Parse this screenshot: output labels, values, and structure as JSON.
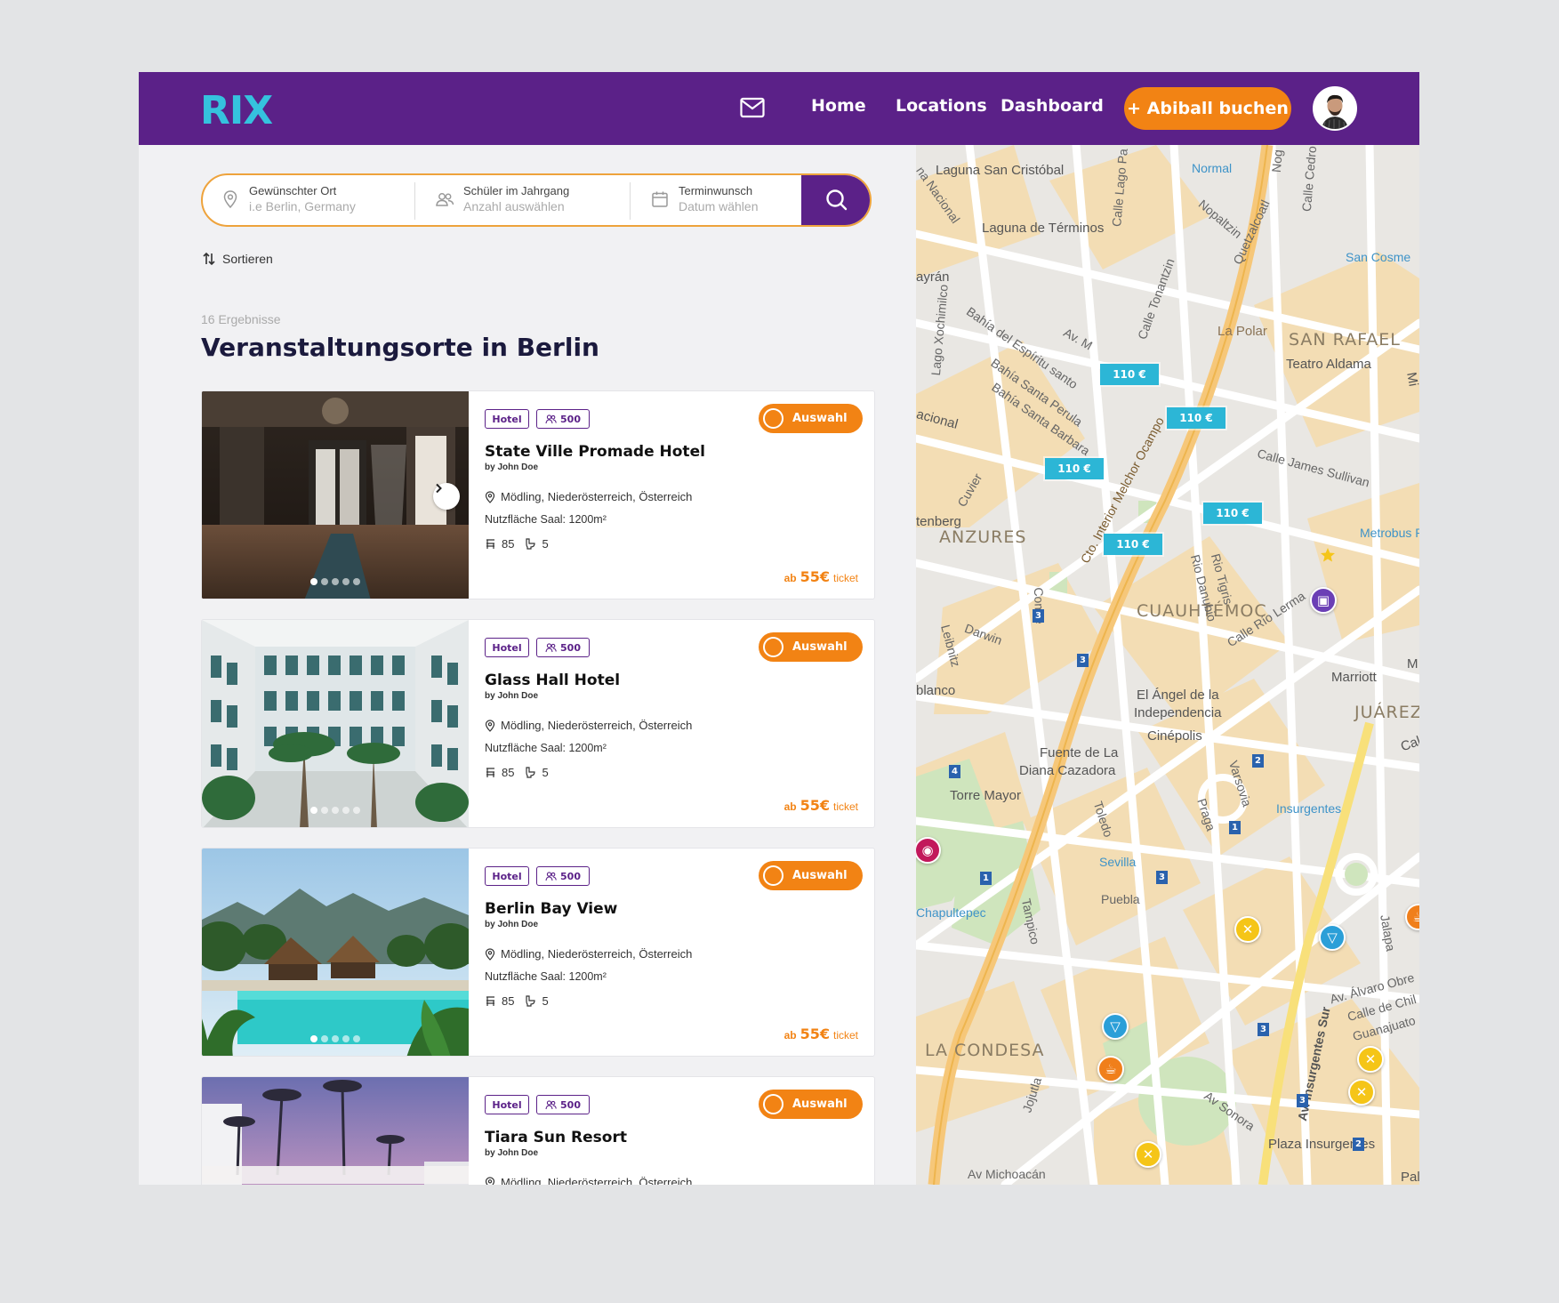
{
  "header": {
    "logo": "RIX",
    "nav": [
      "Home",
      "Locations",
      "Dashboard"
    ],
    "cta": "+ Abiball buchen"
  },
  "search": {
    "location": {
      "label": "Gewünschter Ort",
      "placeholder": "i.e Berlin, Germany"
    },
    "students": {
      "label": "Schüler im Jahrgang",
      "placeholder": "Anzahl auswählen"
    },
    "date": {
      "label": "Terminwunsch",
      "placeholder": "Datum wählen"
    }
  },
  "sort_label": "Sortieren",
  "results_count": "16 Ergebnisse",
  "page_title": "Veranstaltungsorte in Berlin",
  "listings": [
    {
      "tag_type": "Hotel",
      "capacity": "500",
      "select_label": "Auswahl",
      "title": "State Ville Promade Hotel",
      "by": "by John Doe",
      "location": "Mödling, Niederösterreich, Österreich",
      "area": "Nutzfläche Saal: 1200m²",
      "seats": "85",
      "toilets": "5",
      "price_prefix": "ab",
      "price": "55€",
      "price_unit": "ticket"
    },
    {
      "tag_type": "Hotel",
      "capacity": "500",
      "select_label": "Auswahl",
      "title": "Glass Hall Hotel",
      "by": "by John Doe",
      "location": "Mödling, Niederösterreich, Österreich",
      "area": "Nutzfläche Saal: 1200m²",
      "seats": "85",
      "toilets": "5",
      "price_prefix": "ab",
      "price": "55€",
      "price_unit": "ticket"
    },
    {
      "tag_type": "Hotel",
      "capacity": "500",
      "select_label": "Auswahl",
      "title": "Berlin Bay View",
      "by": "by John Doe",
      "location": "Mödling, Niederösterreich, Österreich",
      "area": "Nutzfläche Saal: 1200m²",
      "seats": "85",
      "toilets": "5",
      "price_prefix": "ab",
      "price": "55€",
      "price_unit": "ticket"
    },
    {
      "tag_type": "Hotel",
      "capacity": "500",
      "select_label": "Auswahl",
      "title": "Tiara Sun Resort",
      "by": "by John Doe",
      "location": "Mödling, Niederösterreich, Österreich"
    }
  ],
  "map": {
    "price_pins": [
      "110 €",
      "110 €",
      "110 €",
      "110 €",
      "110 €"
    ],
    "districts": [
      "SAN RAFAEL",
      "ANZURES",
      "CUAUHTÉMOC",
      "JUÁREZ",
      "LA CONDESA"
    ],
    "labels": [
      "Laguna San Cristóbal",
      "Laguna de Términos",
      "Normal",
      "San Cosme",
      "La Polar",
      "Teatro Aldama",
      "Calle James Sullivan",
      "Metrobus R",
      "Marriott",
      "El Ángel de la",
      "Independencia",
      "Cinépolis",
      "Fuente de La",
      "Diana Cazadora",
      "Torre Mayor",
      "Insurgentes",
      "Sevilla",
      "Chapultepec",
      "Puebla",
      "Plaza Insurgentes",
      "Av Michoacán",
      "Calle Río Lerma",
      "Av. Insurgentes Sur",
      "Darwin",
      "Toledo",
      "Varsovia",
      "Praga",
      "Tampico",
      "Av Sonora",
      "Jojutla",
      "Av. Álvaro Obre",
      "Calle de Chil",
      "Guanajuato",
      "Nopaltzin",
      "Quetzalcoatl",
      "Bahía del Espíritu santo",
      "Bahía Santa Perula",
      "Bahía Santa Barbara",
      "Rio Danubio",
      "Rio Tigris",
      "Comte",
      "Cuvier",
      "Leibnitz",
      "Lago Xochimilco",
      "Calle Tonantzin",
      "Cto. Interior Melchor Ocampo",
      "tenberg",
      "blanco",
      "acional",
      "ayrán",
      "Mi",
      "M",
      "Cal",
      "Pal",
      "Jalapa",
      "Calle Lago Pa",
      "Calle Cedro",
      "Nog",
      "Av. M",
      "na Nacional"
    ]
  },
  "colors": {
    "brand_purple": "#5b2188",
    "logo_cyan": "#35c2de",
    "accent_orange": "#f28314",
    "pin_cyan": "#2cb6d6"
  }
}
